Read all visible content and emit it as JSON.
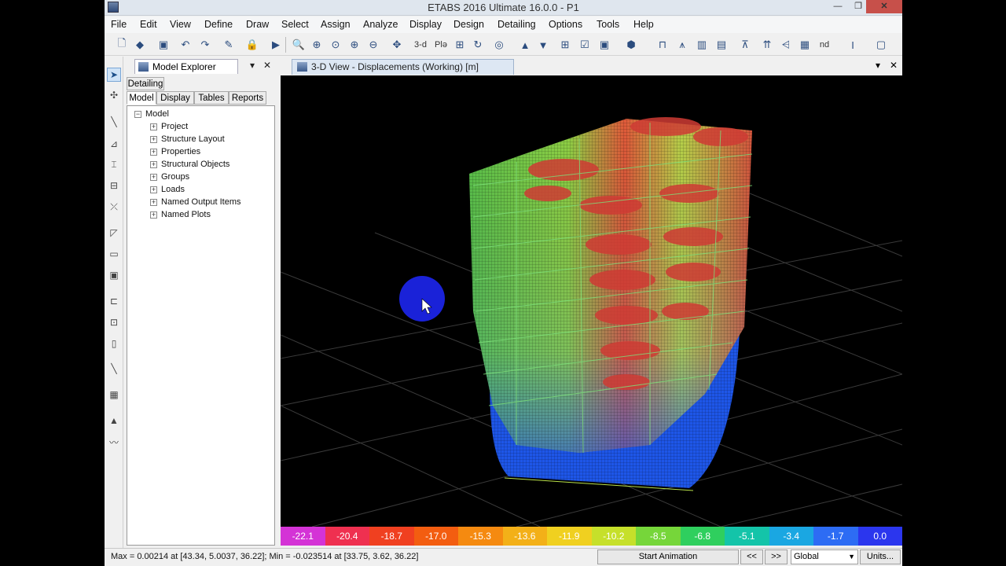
{
  "window": {
    "title": "ETABS 2016 Ultimate 16.0.0 - P1",
    "min_glyph": "—",
    "max_glyph": "❐",
    "close_glyph": "✕"
  },
  "menu": [
    "File",
    "Edit",
    "View",
    "Define",
    "Draw",
    "Select",
    "Assign",
    "Analyze",
    "Display",
    "Design",
    "Detailing",
    "Options",
    "Tools",
    "Help"
  ],
  "toolbar": {
    "view_3d_label": "3-d",
    "plan_label": "Plǝ",
    "nd_label": "nd"
  },
  "explorer": {
    "title": "Model Explorer",
    "pin_glyph": "▾",
    "close_glyph": "✕",
    "detailing_tab": "Detailing",
    "tabs": [
      "Model",
      "Display",
      "Tables",
      "Reports"
    ],
    "tree_root": "Model",
    "tree_items": [
      "Project",
      "Structure Layout",
      "Properties",
      "Structural Objects",
      "Groups",
      "Loads",
      "Named Output Items",
      "Named Plots"
    ],
    "collapse_glyph": "−",
    "expand_glyph": "+"
  },
  "view": {
    "tab_title": "3-D View  - Displacements (Working)  [m]",
    "pin_glyph": "▾",
    "close_glyph": "✕"
  },
  "legend": {
    "values": [
      "-22.1",
      "-20.4",
      "-18.7",
      "-17.0",
      "-15.3",
      "-13.6",
      "-11.9",
      "-10.2",
      "-8.5",
      "-6.8",
      "-5.1",
      "-3.4",
      "-1.7",
      "0.0"
    ],
    "colors": [
      "#d433d6",
      "#ef3050",
      "#f04020",
      "#f35d10",
      "#f58a10",
      "#f3b018",
      "#f0d020",
      "#c6e02a",
      "#76d63a",
      "#2fcf5e",
      "#14c4a9",
      "#1aa7e2",
      "#2d6cf4",
      "#2b36ee"
    ]
  },
  "status": {
    "text": "Max = 0.00214 at [43.34, 5.0037, 36.22];  Min = -0.023514 at [33.75, 3.62, 36.22]",
    "start_animation": "Start Animation",
    "prev": "<<",
    "next": ">>",
    "coord_system": "Global",
    "units": "Units..."
  }
}
